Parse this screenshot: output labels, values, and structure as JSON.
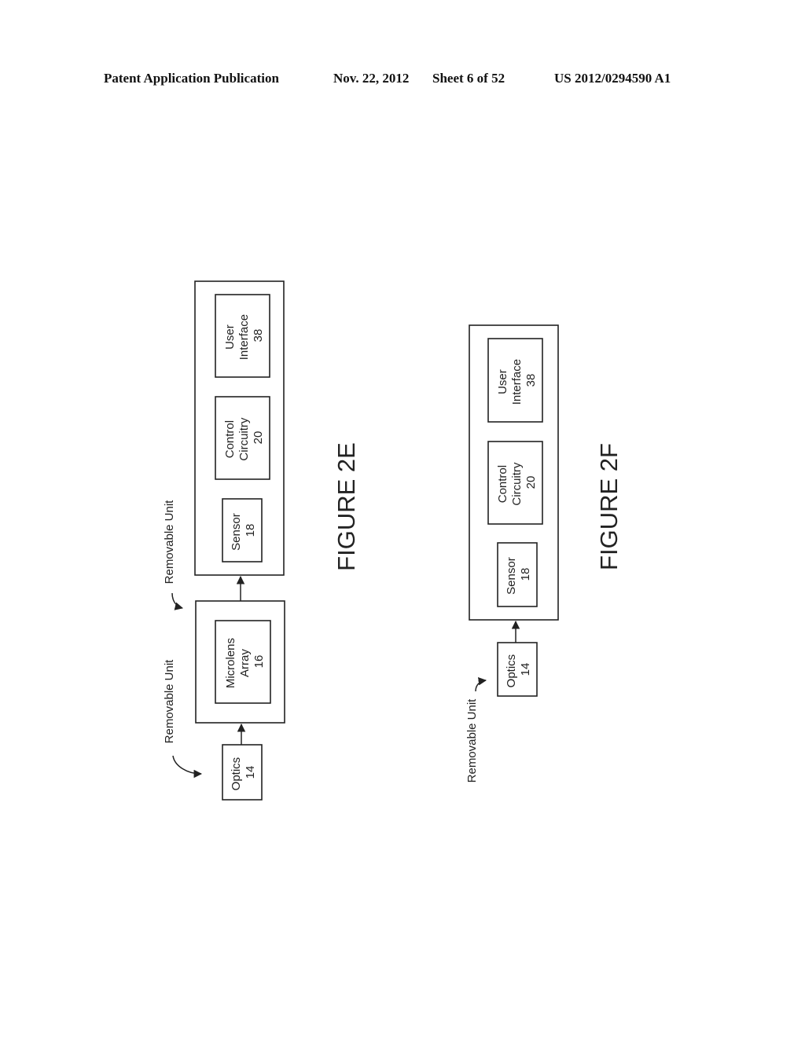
{
  "header": {
    "publication": "Patent Application Publication",
    "date": "Nov. 22, 2012",
    "sheet": "Sheet 6 of 52",
    "number": "US 2012/0294590 A1"
  },
  "figure_2e": {
    "caption": "FIGURE 2E",
    "removable_label_1": "Removable Unit",
    "removable_label_2": "Removable Unit",
    "optics": {
      "name": "Optics",
      "num": "14"
    },
    "microlens": {
      "name1": "Microlens",
      "name2": "Array",
      "num": "16"
    },
    "sensor": {
      "name": "Sensor",
      "num": "18"
    },
    "control": {
      "name1": "Control",
      "name2": "Circuitry",
      "num": "20"
    },
    "ui": {
      "name1": "User",
      "name2": "Interface",
      "num": "38"
    }
  },
  "figure_2f": {
    "caption": "FIGURE 2F",
    "removable_label": "Removable Unit",
    "optics": {
      "name": "Optics",
      "num": "14"
    },
    "sensor": {
      "name": "Sensor",
      "num": "18"
    },
    "control": {
      "name1": "Control",
      "name2": "Circuitry",
      "num": "20"
    },
    "ui": {
      "name1": "User",
      "name2": "Interface",
      "num": "38"
    }
  }
}
